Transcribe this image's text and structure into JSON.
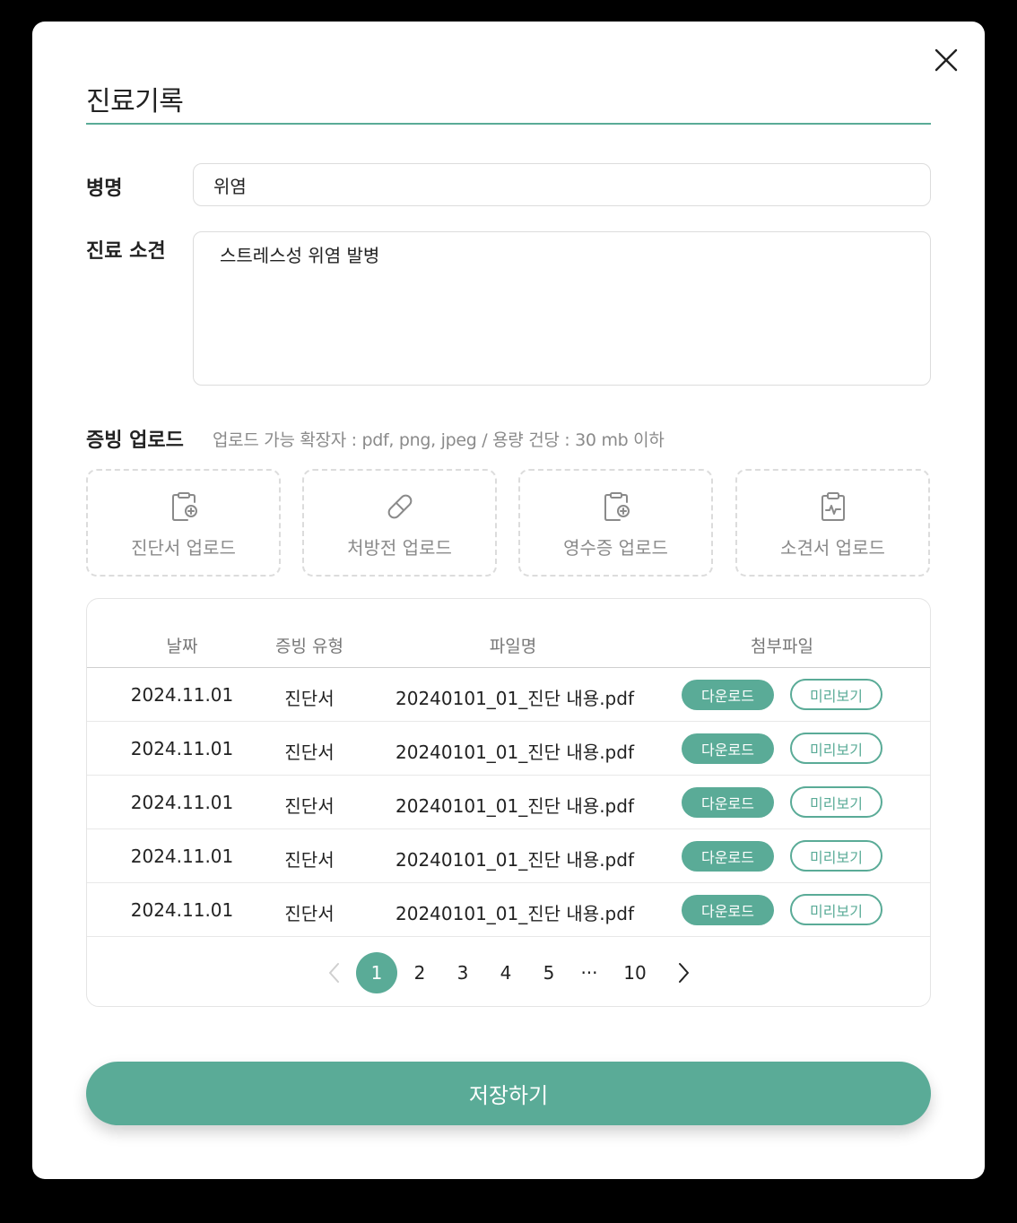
{
  "modal": {
    "title": "진료기록"
  },
  "colors": {
    "accent": "#5aab97",
    "border": "#dcdcdc",
    "muted": "#8a8a8a"
  },
  "form": {
    "disease_label": "병명",
    "disease_value": "위염",
    "findings_label": "진료 소견",
    "findings_value": "스트레스성 위염 발병"
  },
  "upload": {
    "label": "증빙 업로드",
    "hint": "업로드 가능 확장자 : pdf, png, jpeg / 용량 건당 : 30 mb 이하",
    "buttons": [
      {
        "label": "진단서 업로드",
        "icon": "document-plus-icon"
      },
      {
        "label": "처방전 업로드",
        "icon": "pill-icon"
      },
      {
        "label": "영수증 업로드",
        "icon": "document-plus-icon"
      },
      {
        "label": "소견서 업로드",
        "icon": "clipboard-pulse-icon"
      }
    ]
  },
  "table": {
    "headers": {
      "date": "날짜",
      "type": "증빙 유형",
      "filename": "파일명",
      "attachment": "첨부파일"
    },
    "rows": [
      {
        "date": "2024.11.01",
        "type": "진단서",
        "filename": "20240101_01_진단 내용.pdf",
        "download": "다운로드",
        "preview": "미리보기"
      },
      {
        "date": "2024.11.01",
        "type": "진단서",
        "filename": "20240101_01_진단 내용.pdf",
        "download": "다운로드",
        "preview": "미리보기"
      },
      {
        "date": "2024.11.01",
        "type": "진단서",
        "filename": "20240101_01_진단 내용.pdf",
        "download": "다운로드",
        "preview": "미리보기"
      },
      {
        "date": "2024.11.01",
        "type": "진단서",
        "filename": "20240101_01_진단 내용.pdf",
        "download": "다운로드",
        "preview": "미리보기"
      },
      {
        "date": "2024.11.01",
        "type": "진단서",
        "filename": "20240101_01_진단 내용.pdf",
        "download": "다운로드",
        "preview": "미리보기"
      }
    ]
  },
  "pagination": {
    "pages": [
      "1",
      "2",
      "3",
      "4",
      "5",
      "···",
      "10"
    ],
    "current": "1"
  },
  "save_label": "저장하기"
}
